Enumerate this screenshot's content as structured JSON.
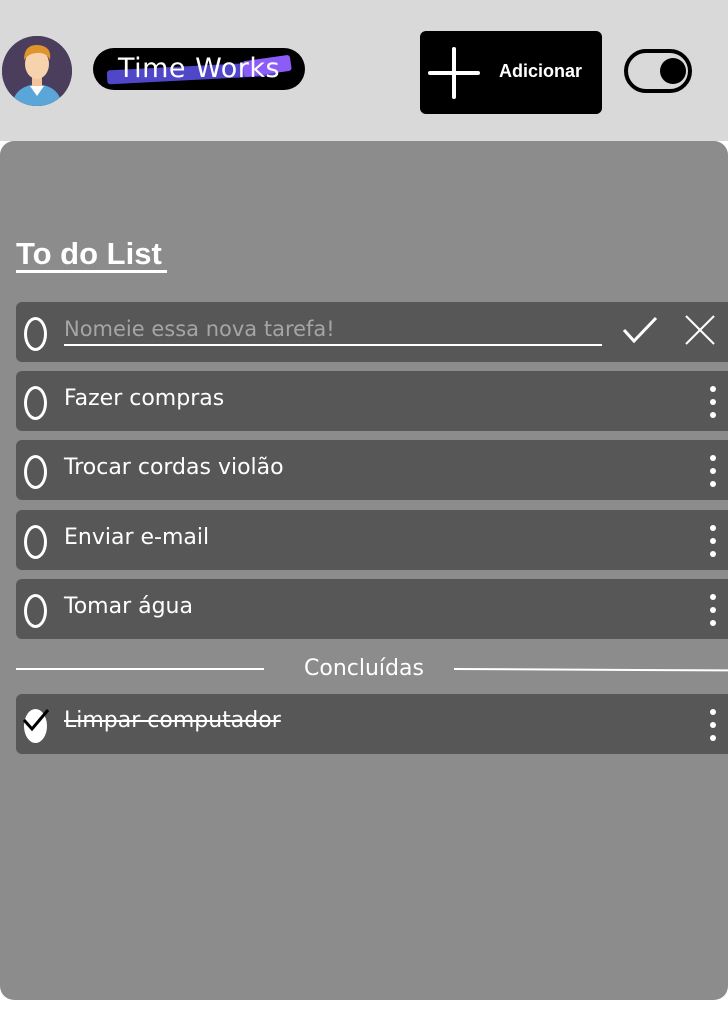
{
  "header": {
    "logo_text": "Time Works",
    "add_button_label": "Adicionar"
  },
  "list": {
    "title": "To do List",
    "new_task_placeholder": "Nomeie essa nova tarefa!",
    "new_task_value": "",
    "pending_tasks": [
      {
        "label": "Fazer compras",
        "done": false
      },
      {
        "label": "Trocar cordas violão",
        "done": false
      },
      {
        "label": "Enviar e-mail",
        "done": false
      },
      {
        "label": "Tomar água",
        "done": false
      }
    ],
    "completed_heading": "Concluídas",
    "completed_tasks": [
      {
        "label": "Limpar computador",
        "done": true
      }
    ]
  },
  "icons": [
    "plus-icon",
    "check-icon",
    "close-icon",
    "kebab-menu-icon",
    "theme-toggle"
  ],
  "colors": {
    "header_bg": "#d9d9d9",
    "panel_bg": "#8c8c8c",
    "task_row_bg": "#575757",
    "button_bg": "#000000",
    "text": "#ffffff"
  }
}
